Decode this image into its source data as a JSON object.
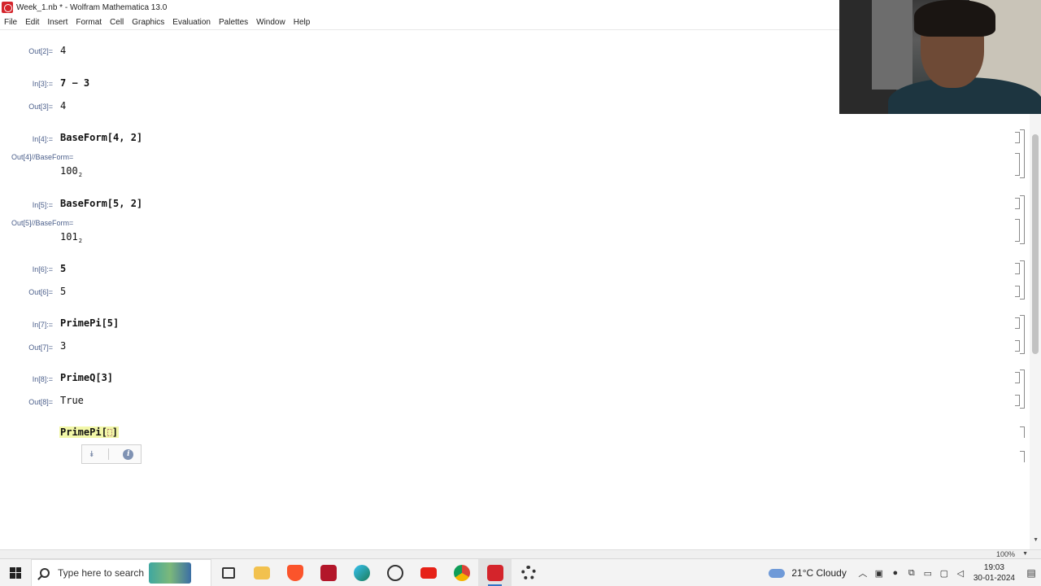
{
  "window": {
    "title": "Week_1.nb * - Wolfram Mathematica 13.0"
  },
  "menu": [
    "File",
    "Edit",
    "Insert",
    "Format",
    "Cell",
    "Graphics",
    "Evaluation",
    "Palettes",
    "Window",
    "Help"
  ],
  "cells": {
    "out2": {
      "label": "Out[2]=",
      "value": "4"
    },
    "in3": {
      "label": "In[3]:=",
      "value": "7 − 3"
    },
    "out3": {
      "label": "Out[3]=",
      "value": "4"
    },
    "in4": {
      "label": "In[4]:=",
      "value": "BaseForm[4, 2]"
    },
    "out4": {
      "label": "Out[4]//BaseForm=",
      "value": "100",
      "base": "2"
    },
    "in5": {
      "label": "In[5]:=",
      "value": "BaseForm[5, 2]"
    },
    "out5": {
      "label": "Out[5]//BaseForm=",
      "value": "101",
      "base": "2"
    },
    "in6": {
      "label": "In[6]:=",
      "value": "5"
    },
    "out6": {
      "label": "Out[6]=",
      "value": "5"
    },
    "in7": {
      "label": "In[7]:=",
      "value": "PrimePi[5]"
    },
    "out7": {
      "label": "Out[7]=",
      "value": "3"
    },
    "in8": {
      "label": "In[8]:=",
      "value": "PrimeQ[3]"
    },
    "out8": {
      "label": "Out[8]=",
      "value": "True"
    },
    "current": {
      "head": "PrimePi[",
      "tail": "]"
    }
  },
  "status": {
    "zoom": "100%"
  },
  "taskbar": {
    "search_placeholder": "Type here to search",
    "weather": "21°C  Cloudy",
    "time": "19:03",
    "date": "30-01-2024"
  },
  "colors": {
    "label": "#4a5e8a",
    "highlight": "#f2f7a8",
    "app_icon": "#d4242b",
    "taskbar_accent": "#3173c6"
  }
}
